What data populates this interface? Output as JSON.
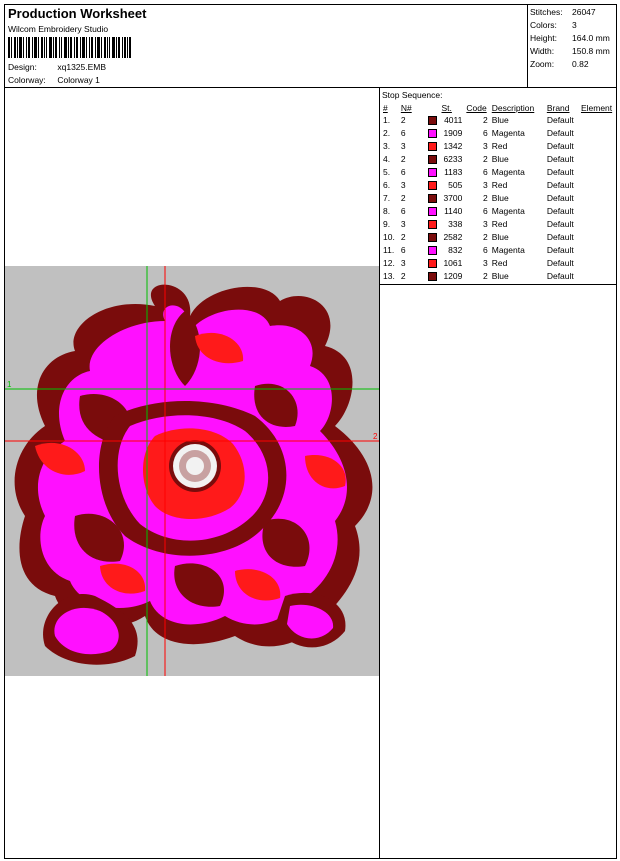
{
  "header": {
    "title": "Production Worksheet",
    "software": "Wilcom  Embroidery Studio",
    "design_label": "Design:",
    "design_value": "xq1325.EMB",
    "colorway_label": "Colorway:",
    "colorway_value": "Colorway 1"
  },
  "stats": [
    {
      "label": "Stitches:",
      "value": "26047"
    },
    {
      "label": "Colors:",
      "value": "3"
    },
    {
      "label": "Height:",
      "value": "164.0 mm"
    },
    {
      "label": "Width:",
      "value": "150.8 mm"
    },
    {
      "label": "Zoom:",
      "value": "0.82"
    }
  ],
  "stop_sequence": {
    "title": "Stop Sequence:",
    "headers": [
      "#",
      "N#",
      "St.",
      "Code",
      "Description",
      "Brand",
      "Element"
    ],
    "rows": [
      {
        "num": "1.",
        "n": "2",
        "color": "#7a0c0c",
        "st": "4011",
        "code": "2",
        "desc": "Blue",
        "brand": "Default",
        "element": ""
      },
      {
        "num": "2.",
        "n": "6",
        "color": "#ff10ff",
        "st": "1909",
        "code": "6",
        "desc": "Magenta",
        "brand": "Default",
        "element": ""
      },
      {
        "num": "3.",
        "n": "3",
        "color": "#ff1a1a",
        "st": "1342",
        "code": "3",
        "desc": "Red",
        "brand": "Default",
        "element": ""
      },
      {
        "num": "4.",
        "n": "2",
        "color": "#7a0c0c",
        "st": "6233",
        "code": "2",
        "desc": "Blue",
        "brand": "Default",
        "element": ""
      },
      {
        "num": "5.",
        "n": "6",
        "color": "#ff10ff",
        "st": "1183",
        "code": "6",
        "desc": "Magenta",
        "brand": "Default",
        "element": ""
      },
      {
        "num": "6.",
        "n": "3",
        "color": "#ff1a1a",
        "st": "505",
        "code": "3",
        "desc": "Red",
        "brand": "Default",
        "element": ""
      },
      {
        "num": "7.",
        "n": "2",
        "color": "#7a0c0c",
        "st": "3700",
        "code": "2",
        "desc": "Blue",
        "brand": "Default",
        "element": ""
      },
      {
        "num": "8.",
        "n": "6",
        "color": "#ff10ff",
        "st": "1140",
        "code": "6",
        "desc": "Magenta",
        "brand": "Default",
        "element": ""
      },
      {
        "num": "9.",
        "n": "3",
        "color": "#ff1a1a",
        "st": "338",
        "code": "3",
        "desc": "Red",
        "brand": "Default",
        "element": ""
      },
      {
        "num": "10.",
        "n": "2",
        "color": "#7a0c0c",
        "st": "2582",
        "code": "2",
        "desc": "Blue",
        "brand": "Default",
        "element": ""
      },
      {
        "num": "11.",
        "n": "6",
        "color": "#ff10ff",
        "st": "832",
        "code": "6",
        "desc": "Magenta",
        "brand": "Default",
        "element": ""
      },
      {
        "num": "12.",
        "n": "3",
        "color": "#ff1a1a",
        "st": "1061",
        "code": "3",
        "desc": "Red",
        "brand": "Default",
        "element": ""
      },
      {
        "num": "13.",
        "n": "2",
        "color": "#7a0c0c",
        "st": "1209",
        "code": "2",
        "desc": "Blue",
        "brand": "Default",
        "element": ""
      }
    ]
  },
  "design_preview": {
    "background": "#c0c0c0",
    "guide_green": "#00c000",
    "guide_red": "#ff0000",
    "guide_label_1": "1",
    "guide_label_2": "2",
    "colors": {
      "dark": "#7a0c0c",
      "magenta": "#ff10ff",
      "red": "#ff1a1a",
      "white": "#f2f2f2"
    }
  }
}
